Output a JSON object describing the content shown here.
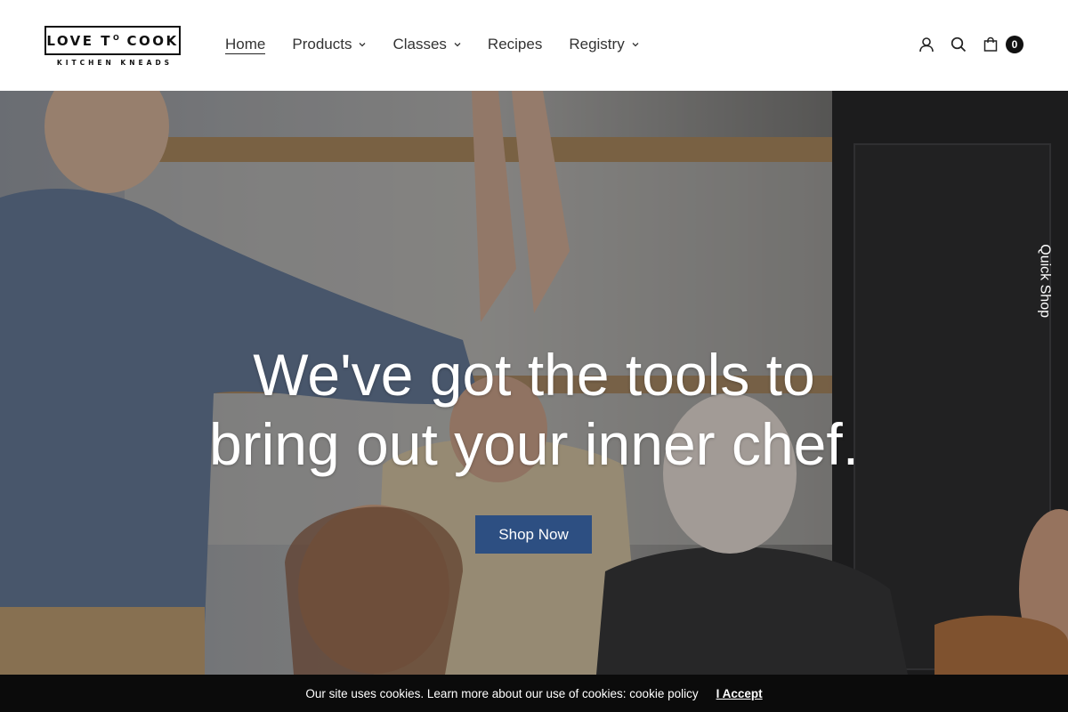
{
  "brand": {
    "name_part1": "LOVE T",
    "name_sup": "O",
    "name_part2": " COOK",
    "tagline": "KITCHEN KNEADS"
  },
  "nav": {
    "items": [
      {
        "label": "Home",
        "active": true,
        "dropdown": false
      },
      {
        "label": "Products",
        "active": false,
        "dropdown": true
      },
      {
        "label": "Classes",
        "active": false,
        "dropdown": true
      },
      {
        "label": "Recipes",
        "active": false,
        "dropdown": false
      },
      {
        "label": "Registry",
        "active": false,
        "dropdown": true
      }
    ]
  },
  "header_icons": {
    "account": "user-icon",
    "search": "search-icon",
    "cart": "shopping-bag-icon",
    "cart_count": "0"
  },
  "hero": {
    "title_line1": "We've got the tools to",
    "title_line2": "bring out your inner chef.",
    "cta_label": "Shop Now",
    "cta_color": "#2d4f82",
    "side_tab": "Quick Shop"
  },
  "cookie_bar": {
    "message": "Our site uses cookies. Learn more about our use of cookies: cookie policy",
    "accept_label": "I Accept"
  }
}
